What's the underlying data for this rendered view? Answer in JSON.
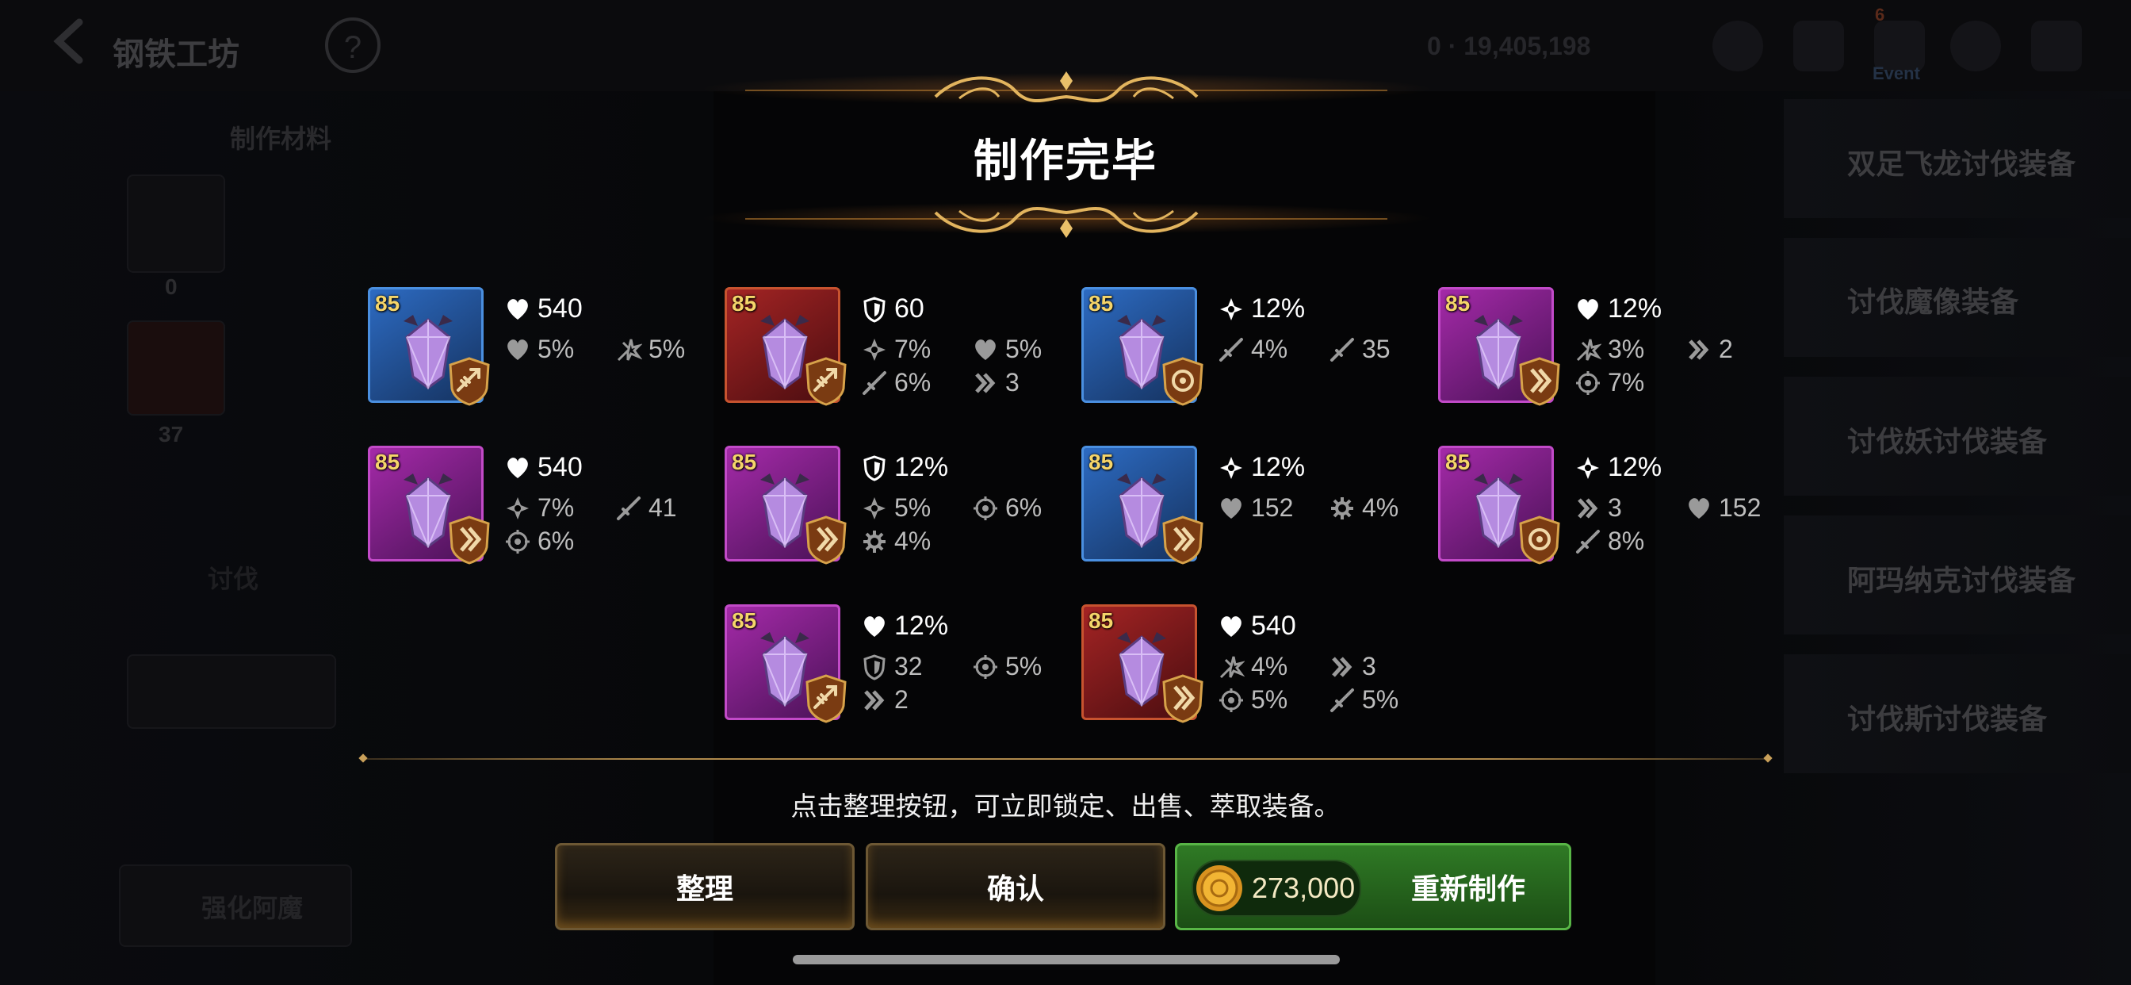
{
  "background": {
    "screen_title": "钢铁工坊",
    "help_label": "?",
    "currency_text": "0 · 19,405,198",
    "event_label": "Event",
    "mail_badge": "6",
    "material_tab": "制作材料",
    "count_a": "0",
    "count_b": "37",
    "side_label": "讨伐",
    "enhance_label": "强化阿魔",
    "right_list": [
      "双足飞龙讨伐装备",
      "讨伐魔像装备",
      "讨伐妖讨伐装备",
      "阿玛纳克讨伐装备",
      "讨伐斯讨伐装备"
    ]
  },
  "modal": {
    "title": "制作完毕",
    "hint": "点击整理按钮，可立即锁定、出售、萃取装备。",
    "buttons": {
      "organize": "整理",
      "confirm": "确认",
      "remake": "重新制作",
      "cost": "273,000"
    }
  },
  "items": [
    {
      "level": "85",
      "rarity": "blue",
      "set": "arrow",
      "main": {
        "icon": "heart",
        "value": "540"
      },
      "subs": [
        {
          "icon": "heart",
          "value": "5%"
        },
        {
          "icon": "crit-dmg",
          "value": "5%"
        }
      ]
    },
    {
      "level": "85",
      "rarity": "red",
      "set": "arrow",
      "main": {
        "icon": "shield",
        "value": "60"
      },
      "subs": [
        {
          "icon": "crit",
          "value": "7%"
        },
        {
          "icon": "heart",
          "value": "5%"
        },
        {
          "icon": "sword",
          "value": "6%"
        },
        {
          "icon": "speed",
          "value": "3"
        }
      ]
    },
    {
      "level": "85",
      "rarity": "blue",
      "set": "target",
      "main": {
        "icon": "crit",
        "value": "12%"
      },
      "subs": [
        {
          "icon": "sword",
          "value": "4%"
        },
        {
          "icon": "sword",
          "value": "35"
        }
      ]
    },
    {
      "level": "85",
      "rarity": "purple",
      "set": "speed",
      "main": {
        "icon": "heart",
        "value": "12%"
      },
      "subs": [
        {
          "icon": "crit-dmg",
          "value": "3%"
        },
        {
          "icon": "speed",
          "value": "2"
        },
        {
          "icon": "target",
          "value": "7%"
        }
      ]
    },
    {
      "level": "85",
      "rarity": "purple",
      "set": "speed",
      "main": {
        "icon": "heart",
        "value": "540"
      },
      "subs": [
        {
          "icon": "crit",
          "value": "7%"
        },
        {
          "icon": "sword",
          "value": "41"
        },
        {
          "icon": "target",
          "value": "6%"
        }
      ]
    },
    {
      "level": "85",
      "rarity": "purple",
      "set": "speed",
      "main": {
        "icon": "shield",
        "value": "12%"
      },
      "subs": [
        {
          "icon": "crit",
          "value": "5%"
        },
        {
          "icon": "target",
          "value": "6%"
        },
        {
          "icon": "gear",
          "value": "4%"
        }
      ]
    },
    {
      "level": "85",
      "rarity": "blue",
      "set": "speed",
      "main": {
        "icon": "crit",
        "value": "12%"
      },
      "subs": [
        {
          "icon": "heart",
          "value": "152"
        },
        {
          "icon": "gear",
          "value": "4%"
        }
      ]
    },
    {
      "level": "85",
      "rarity": "purple",
      "set": "target",
      "main": {
        "icon": "crit",
        "value": "12%"
      },
      "subs": [
        {
          "icon": "speed",
          "value": "3"
        },
        {
          "icon": "heart",
          "value": "152"
        },
        {
          "icon": "sword",
          "value": "8%"
        }
      ]
    },
    {
      "level": "85",
      "rarity": "purple",
      "set": "arrow",
      "main": {
        "icon": "heart",
        "value": "12%"
      },
      "subs": [
        {
          "icon": "shield",
          "value": "32"
        },
        {
          "icon": "target",
          "value": "5%"
        },
        {
          "icon": "speed",
          "value": "2"
        }
      ]
    },
    {
      "level": "85",
      "rarity": "red",
      "set": "speed",
      "main": {
        "icon": "heart",
        "value": "540"
      },
      "subs": [
        {
          "icon": "crit-dmg",
          "value": "4%"
        },
        {
          "icon": "speed",
          "value": "3"
        },
        {
          "icon": "target",
          "value": "5%"
        },
        {
          "icon": "sword",
          "value": "5%"
        }
      ]
    }
  ],
  "colors": {
    "accent_gold": "#c9a05a",
    "button_green": "#2f7a25",
    "rarity_blue": "#2d6bc2",
    "rarity_red": "#a42424",
    "rarity_purple": "#a42aa8"
  }
}
